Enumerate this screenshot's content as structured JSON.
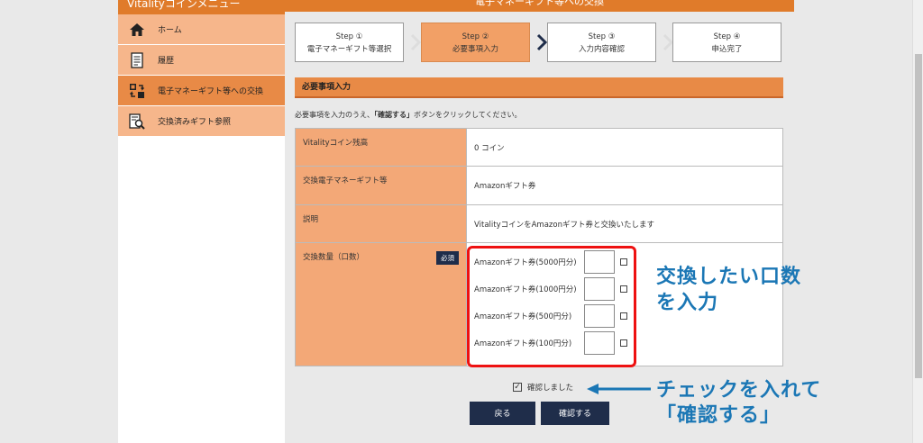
{
  "sidebar": {
    "title": "Vitalityコインメニュー",
    "items": [
      {
        "label": "ホーム",
        "icon": "home-icon"
      },
      {
        "label": "履歴",
        "icon": "document-icon"
      },
      {
        "label": "電子マネーギフト等への交換",
        "icon": "exchange-icon"
      },
      {
        "label": "交換済みギフト参照",
        "icon": "search-document-icon"
      }
    ]
  },
  "header": {
    "title": "電子マネーギフト等への交換"
  },
  "steps": [
    {
      "num": "Step ①",
      "label": "電子マネーギフト等選択"
    },
    {
      "num": "Step ②",
      "label": "必要事項入力"
    },
    {
      "num": "Step ③",
      "label": "入力内容確認"
    },
    {
      "num": "Step ④",
      "label": "申込完了"
    }
  ],
  "section": {
    "title": "必要事項入力"
  },
  "instruction": {
    "pre": "必要事項を入力のうえ、",
    "bold": "「確認する」",
    "post": "ボタンをクリックしてください。"
  },
  "form": {
    "balance_label": "Vitalityコイン残高",
    "balance_value": "0 コイン",
    "gift_label": "交換電子マネーギフト等",
    "gift_value": "Amazonギフト券",
    "desc_label": "説明",
    "desc_value": "VitalityコインをAmazonギフト券と交換いたします",
    "qty_label": "交換数量（口数）",
    "required_badge": "必須",
    "options": [
      {
        "name": "Amazonギフト券(5000円分)"
      },
      {
        "name": "Amazonギフト券(1000円分)"
      },
      {
        "name": "Amazonギフト券(500円分)"
      },
      {
        "name": "Amazonギフト券(100円分)"
      }
    ]
  },
  "confirm": {
    "label": "確認しました",
    "checked": true,
    "check_mark": "✓"
  },
  "buttons": {
    "back": "戻る",
    "confirm": "確認する"
  },
  "annotations": {
    "ann1_line1": "交換したい口数",
    "ann1_line2": "を入力",
    "ann2_line1": "チェックを入れて",
    "ann2_line2": "「確認する」"
  },
  "colors": {
    "accent": "#e07b2a",
    "navy": "#1f2d4a",
    "highlight_red": "#e11111",
    "annotation_blue": "#1b77b5"
  }
}
